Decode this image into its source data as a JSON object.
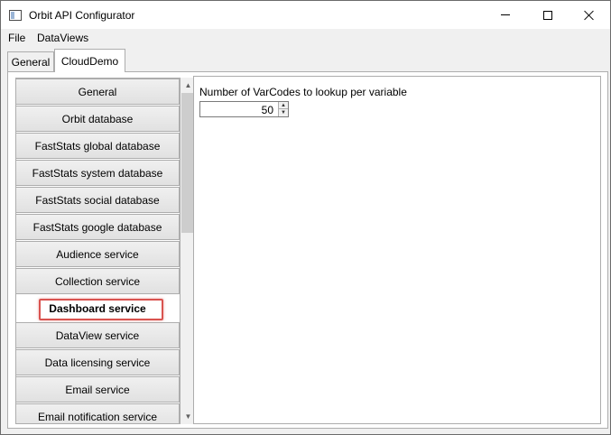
{
  "window": {
    "title": "Orbit API Configurator"
  },
  "menu": {
    "items": [
      "File",
      "DataViews"
    ]
  },
  "tabs": [
    {
      "label": "General",
      "active": false
    },
    {
      "label": "CloudDemo",
      "active": true
    }
  ],
  "nav": {
    "selected_index": 8,
    "items": [
      "General",
      "Orbit database",
      "FastStats global database",
      "FastStats system database",
      "FastStats social database",
      "FastStats google database",
      "Audience service",
      "Collection service",
      "Dashboard service",
      "DataView service",
      "Data licensing service",
      "Email service",
      "Email notification service"
    ]
  },
  "detail": {
    "field_label": "Number of VarCodes to lookup per variable",
    "field_value": "50"
  },
  "colors": {
    "highlight": "#d9534f",
    "window_bg": "#f0f0f0"
  }
}
